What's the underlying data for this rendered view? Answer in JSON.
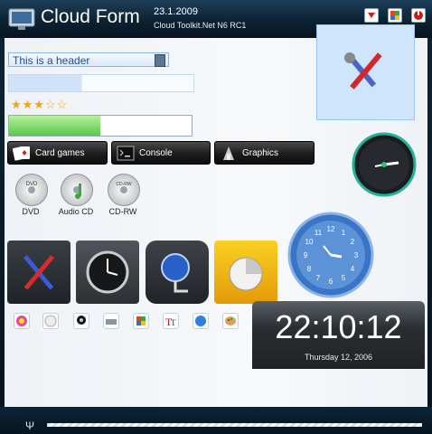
{
  "window": {
    "title": "Cloud Form",
    "date": "23.1.2009",
    "subtitle": "Cloud Toolkit.Net N6 RC1"
  },
  "fields": {
    "header_value": "This is a header"
  },
  "rating": {
    "stars": "★★★☆☆",
    "value": 3,
    "max": 5
  },
  "progress": {
    "fraction": 0.5
  },
  "buttons": {
    "card_games": "Card games",
    "console": "Console",
    "graphics": "Graphics"
  },
  "drives": {
    "dvd": "DVD",
    "audio_cd": "Audio CD",
    "cd_rw": "CD-RW"
  },
  "clock": {
    "time": "22:10:12",
    "date": "Thursday 12, 2006"
  },
  "icons": [
    "tools-icon",
    "clock-icon",
    "network-globe-icon",
    "pie-chart-icon",
    "color-wheel-icon",
    "blank-page-icon",
    "webcam-icon",
    "scanner-icon",
    "windows-flag-icon",
    "font-icon",
    "globe-icon",
    "palette-icon",
    "bar-chart-icon",
    "sigma-icon",
    "info-icon"
  ],
  "colors": {
    "accent": "#1c4d9c",
    "titlebar": "#0c2233",
    "progress_fill": "#58c94c",
    "dark_button": "#1c1c1c"
  }
}
